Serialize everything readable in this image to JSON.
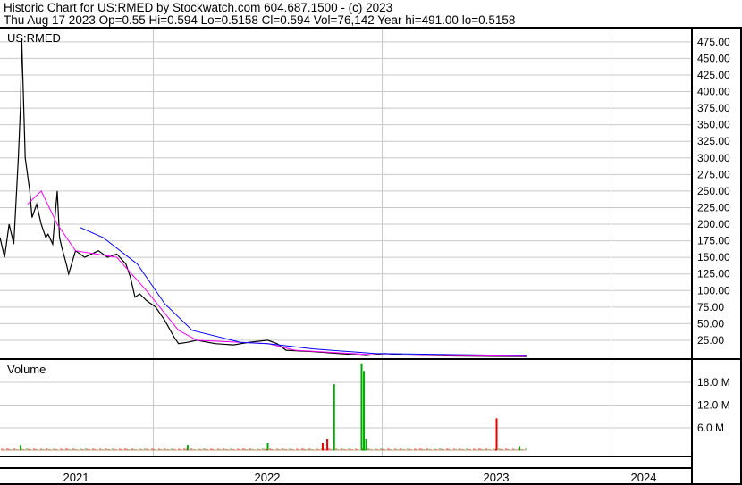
{
  "header": {
    "title": "Historic Chart for US:RMED by Stockwatch.com 604.687.1500 - (c) 2023",
    "quote": "Thu Aug 17 2023   Op=0.55  Hi=0.594  Lo=0.5158  Cl=0.594  Vol=76,142  Year hi=491.00  lo=0.5158"
  },
  "chart_data": {
    "type": "line",
    "title": "US:RMED",
    "volume_label": "Volume",
    "xlim": [
      2021.33,
      2024.35
    ],
    "x_ticks": [
      {
        "label": "2021",
        "at": 2021.67
      },
      {
        "label": "2022",
        "at": 2022.5
      },
      {
        "label": "2023",
        "at": 2023.5
      },
      {
        "label": "2024",
        "at": 2024.17
      }
    ],
    "year_boundaries": [
      2022,
      2023,
      2024
    ],
    "ylim": [
      0,
      490
    ],
    "y_ticks": [
      "475.00",
      "450.00",
      "425.00",
      "400.00",
      "375.00",
      "350.00",
      "325.00",
      "300.00",
      "275.00",
      "250.00",
      "225.00",
      "200.00",
      "175.00",
      "150.00",
      "125.00",
      "100.00",
      "75.00",
      "50.00",
      "25.00"
    ],
    "vol_ylim": [
      0,
      21
    ],
    "vol_ticks": [
      {
        "label": "18.0 M",
        "v": 18
      },
      {
        "label": "12.0 M",
        "v": 12
      },
      {
        "label": "6.0 M",
        "v": 6
      }
    ],
    "colors": {
      "price": "#000000",
      "ma_short": "#ff00ff",
      "ma_long": "#0000ff",
      "vol_up": "#00aa00",
      "vol_down": "#ee0000",
      "grid": "#c8c8c8"
    },
    "price": [
      [
        2021.33,
        180
      ],
      [
        2021.35,
        150
      ],
      [
        2021.37,
        200
      ],
      [
        2021.39,
        170
      ],
      [
        2021.41,
        300
      ],
      [
        2021.42,
        380
      ],
      [
        2021.425,
        480
      ],
      [
        2021.43,
        420
      ],
      [
        2021.44,
        300
      ],
      [
        2021.46,
        250
      ],
      [
        2021.47,
        210
      ],
      [
        2021.49,
        230
      ],
      [
        2021.51,
        200
      ],
      [
        2021.53,
        180
      ],
      [
        2021.54,
        185
      ],
      [
        2021.56,
        170
      ],
      [
        2021.58,
        250
      ],
      [
        2021.59,
        180
      ],
      [
        2021.6,
        165
      ],
      [
        2021.62,
        140
      ],
      [
        2021.63,
        125
      ],
      [
        2021.66,
        160
      ],
      [
        2021.7,
        150
      ],
      [
        2021.76,
        160
      ],
      [
        2021.8,
        150
      ],
      [
        2021.84,
        155
      ],
      [
        2021.88,
        140
      ],
      [
        2021.9,
        120
      ],
      [
        2021.92,
        90
      ],
      [
        2021.94,
        95
      ],
      [
        2021.97,
        85
      ],
      [
        2022.01,
        75
      ],
      [
        2022.05,
        55
      ],
      [
        2022.09,
        30
      ],
      [
        2022.11,
        20
      ],
      [
        2022.15,
        22
      ],
      [
        2022.19,
        25
      ],
      [
        2022.27,
        20
      ],
      [
        2022.35,
        18
      ],
      [
        2022.42,
        22
      ],
      [
        2022.5,
        25
      ],
      [
        2022.54,
        20
      ],
      [
        2022.58,
        10
      ],
      [
        2022.7,
        8
      ],
      [
        2022.81,
        5
      ],
      [
        2022.89,
        3
      ],
      [
        2022.93,
        2
      ],
      [
        2023.01,
        5
      ],
      [
        2023.09,
        3
      ],
      [
        2023.28,
        1.5
      ],
      [
        2023.48,
        0.8
      ],
      [
        2023.63,
        0.6
      ]
    ],
    "ma_short": [
      [
        2021.45,
        230
      ],
      [
        2021.51,
        250
      ],
      [
        2021.58,
        200
      ],
      [
        2021.66,
        160
      ],
      [
        2021.84,
        150
      ],
      [
        2021.97,
        100
      ],
      [
        2022.11,
        40
      ],
      [
        2022.19,
        25
      ],
      [
        2022.5,
        20
      ],
      [
        2022.62,
        10
      ],
      [
        2022.97,
        3
      ],
      [
        2023.63,
        1
      ]
    ],
    "ma_long": [
      [
        2021.68,
        195
      ],
      [
        2021.78,
        180
      ],
      [
        2021.93,
        140
      ],
      [
        2022.05,
        80
      ],
      [
        2022.17,
        40
      ],
      [
        2022.38,
        22
      ],
      [
        2022.5,
        20
      ],
      [
        2022.7,
        12
      ],
      [
        2022.97,
        5
      ],
      [
        2023.63,
        2
      ]
    ],
    "volume_baseline": 0.4,
    "volume_spikes": [
      {
        "t": 2021.42,
        "v": 1.5,
        "dir": "up"
      },
      {
        "t": 2022.15,
        "v": 1.5,
        "dir": "up"
      },
      {
        "t": 2022.5,
        "v": 2,
        "dir": "up"
      },
      {
        "t": 2022.74,
        "v": 2,
        "dir": "down"
      },
      {
        "t": 2022.76,
        "v": 3,
        "dir": "down"
      },
      {
        "t": 2022.79,
        "v": 17.5,
        "dir": "up"
      },
      {
        "t": 2022.91,
        "v": 23,
        "dir": "up"
      },
      {
        "t": 2022.92,
        "v": 21,
        "dir": "up"
      },
      {
        "t": 2022.93,
        "v": 3,
        "dir": "up"
      },
      {
        "t": 2023.5,
        "v": 8.5,
        "dir": "down"
      },
      {
        "t": 2023.6,
        "v": 1.2,
        "dir": "up"
      }
    ]
  }
}
